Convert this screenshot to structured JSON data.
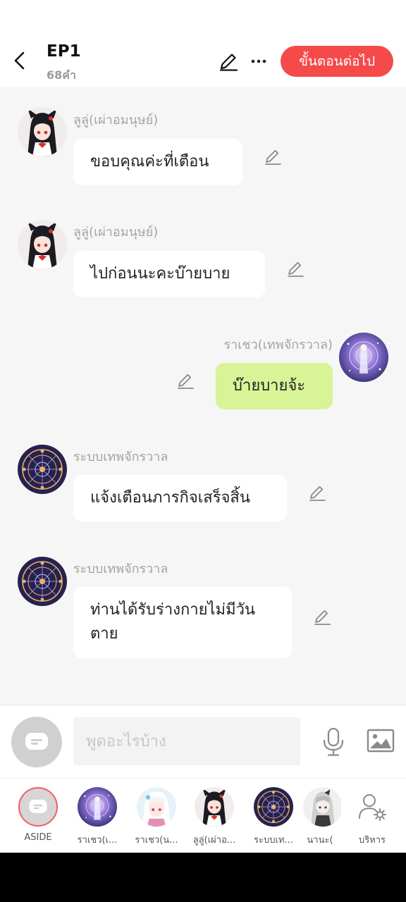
{
  "header": {
    "title": "EP1",
    "subtitle": "68คำ",
    "next_label": "ขั้นตอนต่อไป"
  },
  "messages": [
    {
      "sender": "ลูลู่(เผ่าอมนุษย์)",
      "text": "ขอบคุณค่ะที่เตือน",
      "avatar": "cat-girl-avatar",
      "side": "left"
    },
    {
      "sender": "ลูลู่(เผ่าอมนุษย์)",
      "text": "ไปก่อนนะคะบ๊ายบาย",
      "avatar": "cat-girl-avatar",
      "side": "left"
    },
    {
      "sender": "ราเชว(เทพจักรวาล)",
      "text": "บ๊ายบายจ้ะ",
      "avatar": "cosmic-deity-avatar",
      "side": "right"
    },
    {
      "sender": "ระบบเทพจักรวาล",
      "text": "แจ้งเตือนภารกิจเสร็จสิ้น",
      "avatar": "magic-circle-avatar",
      "side": "left"
    },
    {
      "sender": "ระบบเทพจักรวาล",
      "text": "ท่านได้รับร่างกายไม่มีวันตาย",
      "avatar": "magic-circle-avatar",
      "side": "left"
    }
  ],
  "input": {
    "placeholder": "พูดอะไรบ้าง"
  },
  "characters": [
    {
      "label": "ASIDE",
      "avatar": "aside-icon"
    },
    {
      "label": "ราเชว(เ...",
      "avatar": "cosmic-deity-avatar"
    },
    {
      "label": "ราเชว(น...",
      "avatar": "white-hair-avatar"
    },
    {
      "label": "ลูลู่(เผ่าอ...",
      "avatar": "cat-girl-avatar"
    },
    {
      "label": "ระบบเท...",
      "avatar": "magic-circle-avatar"
    },
    {
      "label": "นานะ(",
      "avatar": "gray-girl-avatar"
    },
    {
      "label": "บริหาร",
      "avatar": "manage-user-icon"
    }
  ],
  "colors": {
    "accent": "#f54a4a",
    "my_bubble": "#d9f397",
    "background": "#f6f6f6"
  }
}
